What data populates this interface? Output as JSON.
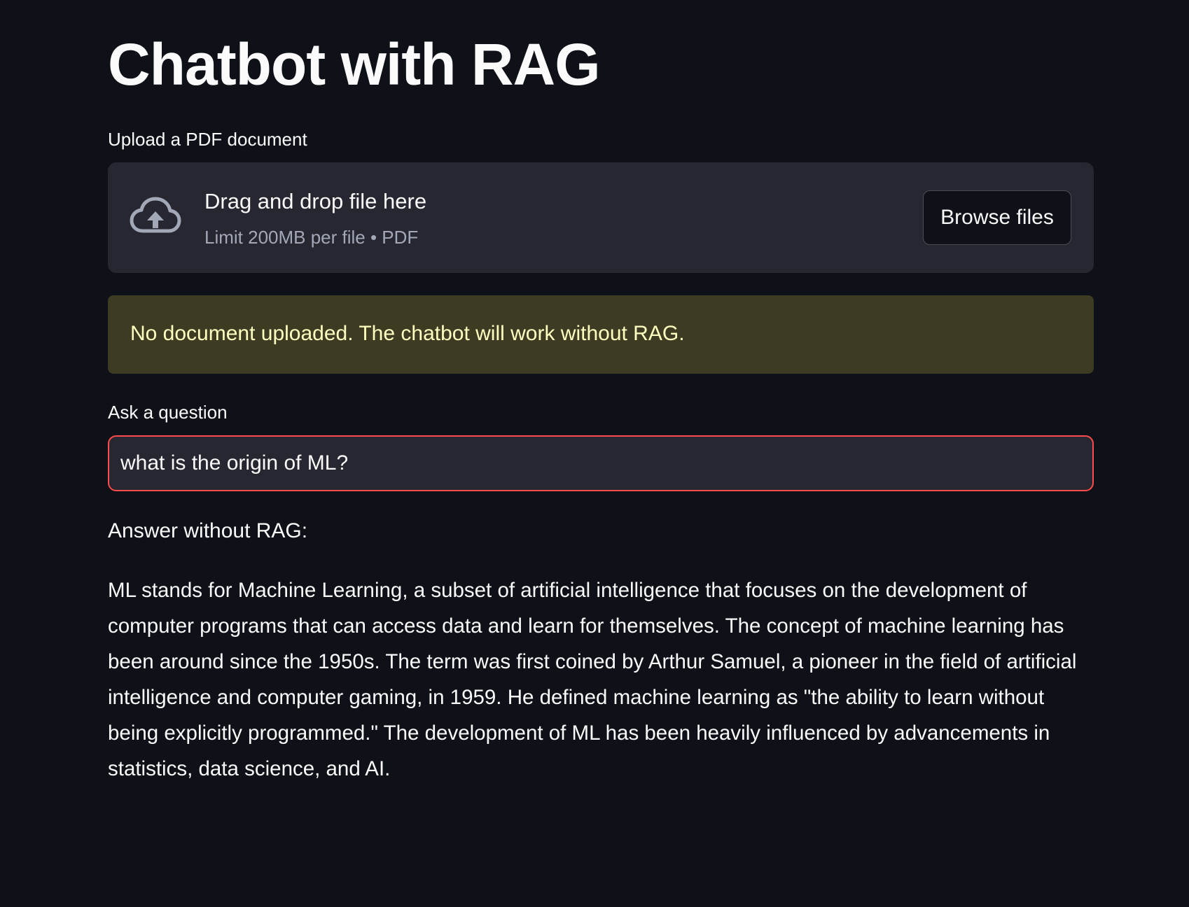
{
  "page": {
    "title": "Chatbot with RAG"
  },
  "uploader": {
    "label": "Upload a PDF document",
    "dropzone_text": "Drag and drop file here",
    "limit_text": "Limit 200MB per file • PDF",
    "browse_label": "Browse files",
    "icon": "cloud-upload-icon"
  },
  "warning": {
    "text": "No document uploaded. The chatbot will work without RAG."
  },
  "question": {
    "label": "Ask a question",
    "value": "what is the origin of ML?"
  },
  "answer": {
    "heading": "Answer without RAG:",
    "body": "ML stands for Machine Learning, a subset of artificial intelligence that focuses on the development of computer programs that can access data and learn for themselves. The concept of machine learning has been around since the 1950s. The term was first coined by Arthur Samuel, a pioneer in the field of artificial intelligence and computer gaming, in 1959. He defined machine learning as \"the ability to learn without being explicitly programmed.\" The development of ML has been heavily influenced by advancements in statistics, data science, and AI."
  },
  "colors": {
    "background": "#0e1117",
    "panel": "#262730",
    "warning_bg": "#3e3b23",
    "warning_text": "#ffffc2",
    "focus_border": "#ff4b4b"
  }
}
